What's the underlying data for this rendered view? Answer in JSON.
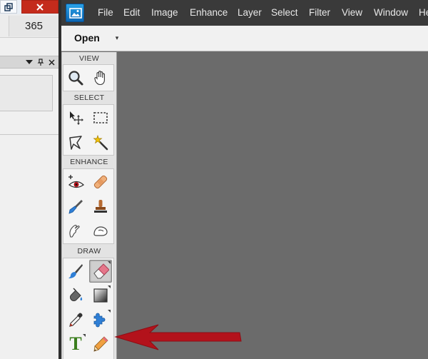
{
  "background_window": {
    "value_cell": "365"
  },
  "menubar": {
    "items": [
      "File",
      "Edit",
      "Image",
      "Enhance",
      "Layer",
      "Select",
      "Filter",
      "View",
      "Window",
      "He"
    ]
  },
  "options_bar": {
    "open_label": "Open",
    "open_dropdown_glyph": "▾"
  },
  "toolbox": {
    "sections": [
      {
        "label": "VIEW",
        "tools": [
          "zoom-tool",
          "hand-tool"
        ]
      },
      {
        "label": "SELECT",
        "tools": [
          "move-tool",
          "rectangular-marquee-tool",
          "lasso-tool",
          "magic-wand-tool"
        ]
      },
      {
        "label": "ENHANCE",
        "tools": [
          "red-eye-removal-tool",
          "spot-healing-brush-tool",
          "smart-brush-tool",
          "clone-stamp-tool",
          "smudge-tool",
          "sponge-tool"
        ]
      },
      {
        "label": "DRAW",
        "tools": [
          "brush-tool",
          "eraser-tool",
          "paint-bucket-tool",
          "gradient-tool",
          "color-picker-tool",
          "custom-shape-tool",
          "type-tool",
          "pencil-tool"
        ]
      }
    ],
    "selected_tool": "eraser-tool",
    "type_tool_glyph": "T"
  },
  "colors": {
    "menubar_bg": "#3a3a3a",
    "canvas_bg": "#6b6b6b",
    "annotation_arrow": "#b3121b",
    "close_button": "#c42b1c"
  }
}
